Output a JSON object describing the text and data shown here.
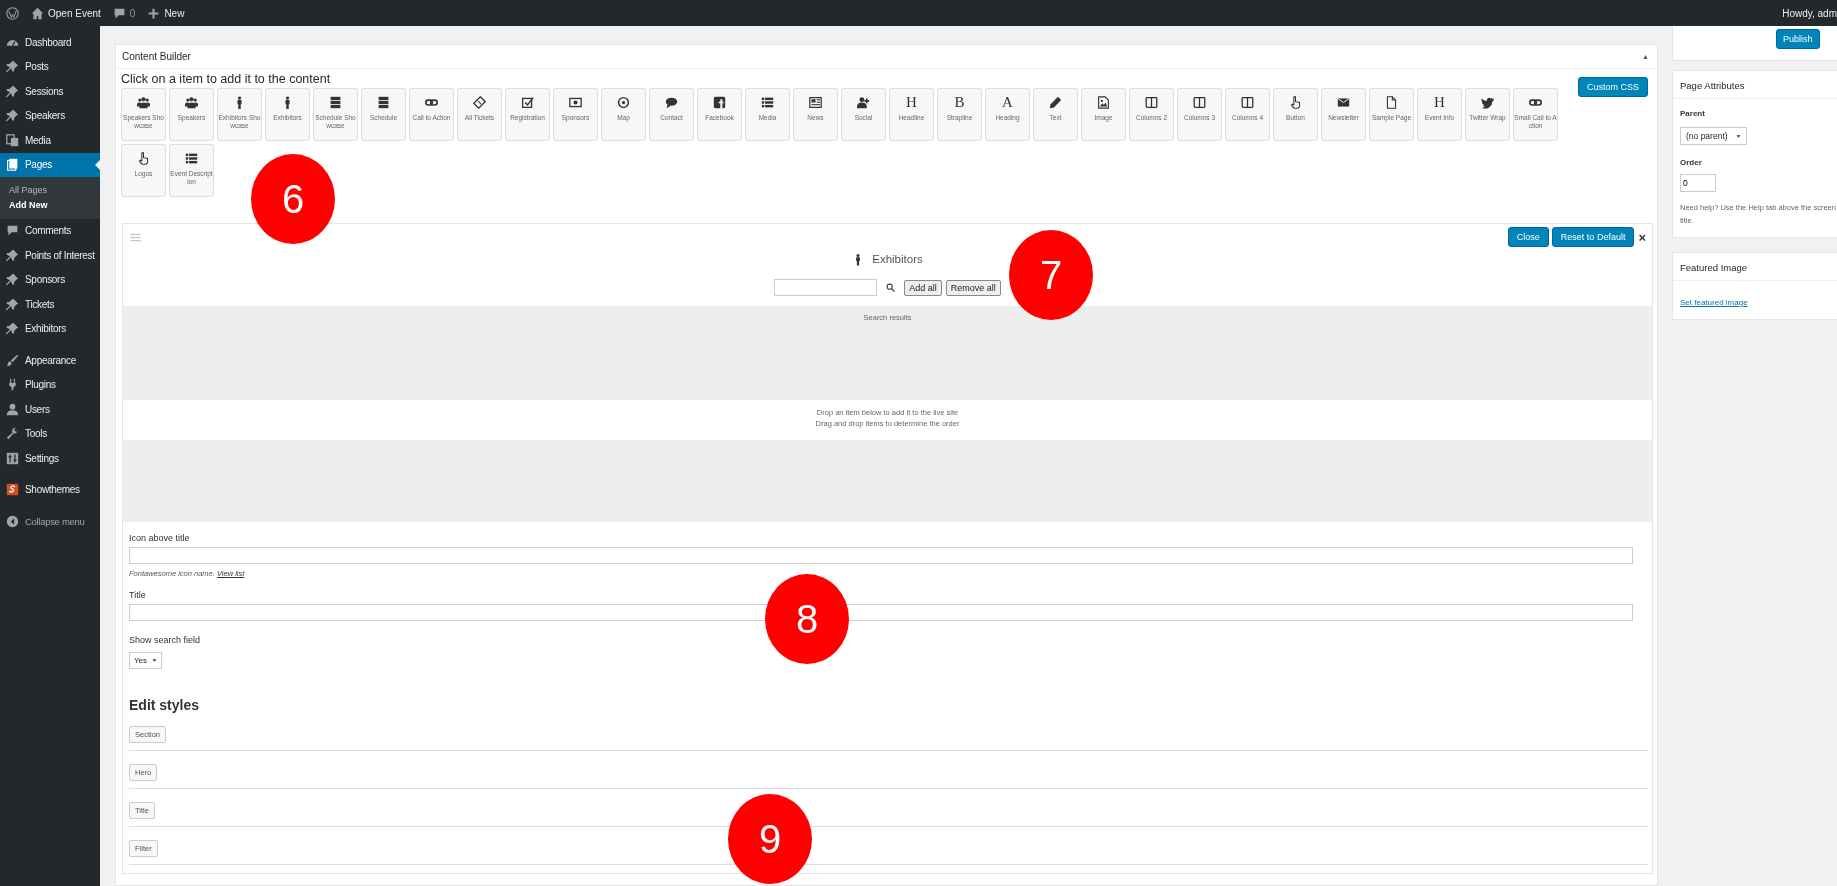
{
  "top_bar": {
    "site": "Open Event",
    "comments": "0",
    "new": "New",
    "greeting": "Howdy, adm"
  },
  "sidebar": {
    "items": [
      {
        "label": "Dashboard",
        "selected": false
      },
      {
        "label": "Posts",
        "selected": false
      },
      {
        "label": "Sessions",
        "selected": false
      },
      {
        "label": "Speakers",
        "selected": false
      },
      {
        "label": "Media",
        "selected": false
      },
      {
        "label": "Pages",
        "selected": true,
        "children": [
          {
            "label": "All Pages",
            "selected": false
          },
          {
            "label": "Add New",
            "selected": true
          }
        ]
      },
      {
        "label": "Comments",
        "selected": false
      },
      {
        "label": "Points of Interest",
        "selected": false
      },
      {
        "label": "Sponsors",
        "selected": false
      },
      {
        "label": "Tickets",
        "selected": false
      },
      {
        "label": "Exhibitors",
        "selected": false
      },
      {
        "label": "Appearance",
        "selected": false
      },
      {
        "label": "Plugins",
        "selected": false
      },
      {
        "label": "Users",
        "selected": false
      },
      {
        "label": "Tools",
        "selected": false
      },
      {
        "label": "Settings",
        "selected": false
      },
      {
        "label": "Showthemes",
        "selected": false
      },
      {
        "label": "Collapse menu",
        "selected": false
      }
    ]
  },
  "content_builder": {
    "title": "Content Builder",
    "collapse_glyph": "▲",
    "instruction": "Click on a item to add it to the content",
    "custom_css_button": "Custom CSS",
    "items": [
      {
        "label": "Speakers Showcase"
      },
      {
        "label": "Speakers"
      },
      {
        "label": "Exhibitors Showcase"
      },
      {
        "label": "Exhibitors"
      },
      {
        "label": "Schedule Showcase"
      },
      {
        "label": "Schedule"
      },
      {
        "label": "Call to Action"
      },
      {
        "label": "All Tickets"
      },
      {
        "label": "Registration"
      },
      {
        "label": "Sponsors"
      },
      {
        "label": "Map"
      },
      {
        "label": "Contact"
      },
      {
        "label": "Facebook"
      },
      {
        "label": "Media"
      },
      {
        "label": "News"
      },
      {
        "label": "Social"
      },
      {
        "label": "Headline",
        "glyph": "H"
      },
      {
        "label": "Strapline",
        "glyph": "B"
      },
      {
        "label": "Heading",
        "glyph": "A"
      },
      {
        "label": "Text"
      },
      {
        "label": "Image"
      },
      {
        "label": "Columns 2"
      },
      {
        "label": "Columns 3"
      },
      {
        "label": "Columns 4"
      },
      {
        "label": "Button"
      },
      {
        "label": "Newsletter"
      },
      {
        "label": "Sample Page"
      },
      {
        "label": "Event Info",
        "glyph": "H"
      },
      {
        "label": "Twitter Wrap"
      },
      {
        "label": "Small Call to Action"
      },
      {
        "label": "Logos"
      },
      {
        "label": "Event Description"
      }
    ],
    "module": {
      "title": "Exhibitors",
      "close_button": "Close",
      "reset_button": "Reset to Default",
      "remove_glyph": "×",
      "add_all_button": "Add all",
      "remove_all_button": "Remove all",
      "search_results_label": "Search results",
      "drop_hint_lines": [
        "Drop an item below to add it to the live site",
        "Drag and drop items to determine the order"
      ],
      "fields": [
        {
          "kind": "text",
          "label": "Icon above title",
          "help": "Fontawesome icon name.",
          "help_link": "View list"
        },
        {
          "kind": "text",
          "label": "Title"
        },
        {
          "kind": "select",
          "label": "Show search field",
          "value": "Yes"
        }
      ],
      "styles_heading": "Edit styles",
      "style_buttons": [
        "Section",
        "Hero",
        "Title",
        "Filter"
      ]
    }
  },
  "publish_button": "Publish",
  "page_attributes": {
    "title": "Page Attributes",
    "parent_label": "Parent",
    "parent_value": "(no parent)",
    "order_label": "Order",
    "order_value": "0",
    "help": "Need help? Use the Help tab above the screen title."
  },
  "featured_image": {
    "title": "Featured Image",
    "link": "Set featured image"
  },
  "callouts": [
    {
      "label": "6"
    },
    {
      "label": "7"
    },
    {
      "label": "8"
    },
    {
      "label": "9"
    }
  ]
}
